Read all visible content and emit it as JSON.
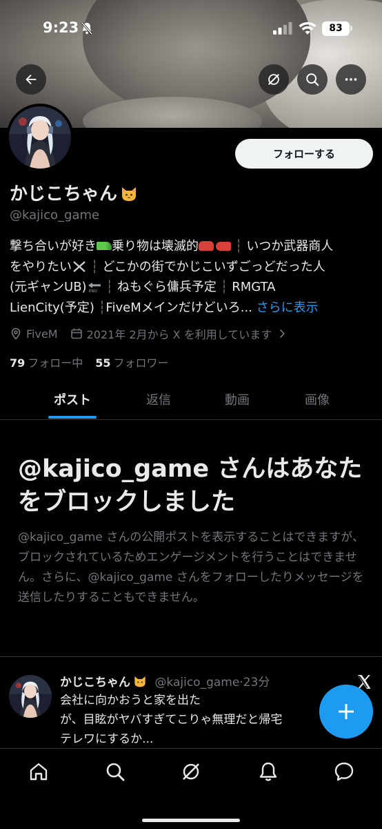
{
  "status_bar": {
    "time": "9:23",
    "battery": "83"
  },
  "header": {
    "back_icon": "arrow-left-icon",
    "grok_icon": "grok-icon",
    "search_icon": "search-icon",
    "more_icon": "more-icon"
  },
  "profile": {
    "display_name": "かじこちゃん",
    "name_emoji": "cat-face-icon",
    "handle": "@kajico_game",
    "follow_label": "フォローする",
    "bio_lines": [
      [
        "撃ち合いが好き",
        "乗り物は壊滅的",
        "いつか武器商人"
      ],
      [
        "をやりたい",
        "どこかの街でかじこいずごっどだった人"
      ],
      [
        "(元ギャンUB)",
        "ねもぐら傭兵予定",
        "RMGTA"
      ],
      [
        "LienCity(予定)",
        "FiveMメインだけどいろ..."
      ]
    ],
    "bio_more": "さらに表示",
    "location": "FiveM",
    "joined": "2021年 2月から X を利用しています",
    "following_count": "79",
    "following_label": "フォロー中",
    "followers_count": "55",
    "followers_label": "フォロワー"
  },
  "tabs": [
    {
      "label": "ポスト",
      "active": true
    },
    {
      "label": "返信",
      "active": false
    },
    {
      "label": "動画",
      "active": false
    },
    {
      "label": "画像",
      "active": false
    }
  ],
  "blocked": {
    "title": "@kajico_game さんはあなたをブロックしました",
    "body": "@kajico_game さんの公開ポストを表示することはできますが、ブロックされているためエンゲージメントを行うことはできません。さらに、@kajico_game さんをフォローしたりメッセージを送信したりすることもできません。"
  },
  "tweet": {
    "name": "かじこちゃん",
    "handle": "@kajico_game",
    "dot": "·",
    "time": "23分",
    "lines": [
      "会社に向かおうと家を出た",
      "が、目眩がヤバすぎてこりゃ無理だと帰宅",
      "テレワにするか..."
    ]
  },
  "bottom_nav": [
    "home-icon",
    "search-icon",
    "grok-icon",
    "notifications-icon",
    "messages-icon"
  ],
  "colors": {
    "accent": "#1d9bf0",
    "background": "#000000",
    "text_primary": "#e7e9ea",
    "text_secondary": "#71767b"
  }
}
